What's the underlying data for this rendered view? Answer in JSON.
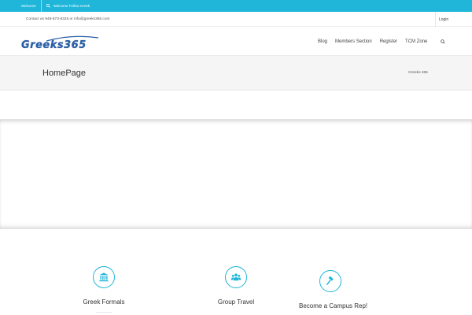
{
  "topbar": {
    "welcome": "Welcome",
    "ticker": "Welcome Fellow Greek"
  },
  "contactbar": {
    "contact": "Contact us 949-873-8328 or info@greeks365.com",
    "login": "Login"
  },
  "logo": {
    "text": "Greeks365"
  },
  "nav": {
    "items": [
      "Blog",
      "Members Section",
      "Register",
      "TCM Zone"
    ]
  },
  "page": {
    "title": "HomePage",
    "breadcrumb": "Greeks 365"
  },
  "features": [
    {
      "label": "Greek Formals",
      "icon": "bank-icon"
    },
    {
      "label": "Group Travel",
      "icon": "group-icon"
    },
    {
      "label": "Become a Campus Rep!",
      "icon": "gavel-icon"
    }
  ],
  "colors": {
    "accent": "#1fb6d9",
    "logo": "#2a5fa8"
  }
}
